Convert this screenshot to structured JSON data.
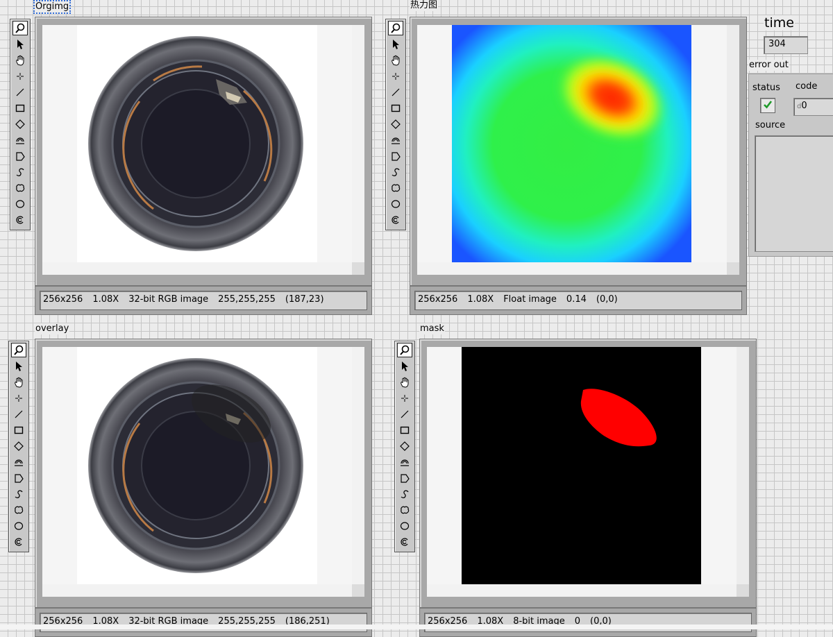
{
  "panels": {
    "orgimg": {
      "label": "Orgimg",
      "status": {
        "size": "256x256",
        "zoom": "1.08X",
        "type": "32-bit RGB image",
        "value": "255,255,255",
        "coords": "(187,23)"
      }
    },
    "heatmap": {
      "label": "热力图",
      "status": {
        "size": "256x256",
        "zoom": "1.08X",
        "type": "Float image",
        "value": "0.14",
        "coords": "(0,0)"
      }
    },
    "overlay": {
      "label": "overlay",
      "status": {
        "size": "256x256",
        "zoom": "1.08X",
        "type": "32-bit RGB image",
        "value": "255,255,255",
        "coords": "(186,251)"
      }
    },
    "mask": {
      "label": "mask",
      "status": {
        "size": "256x256",
        "zoom": "1.08X",
        "type": "8-bit image",
        "value": "0",
        "coords": "(0,0)"
      }
    }
  },
  "time": {
    "label": "time",
    "value": "304"
  },
  "error_out": {
    "label": "error out",
    "status_label": "status",
    "code_label": "code",
    "code_value": "0",
    "code_prefix": "d",
    "source_label": "source",
    "source_value": "",
    "status_ok": true
  },
  "tools": [
    "zoom-tool",
    "pointer-tool",
    "pan-tool",
    "point-tool",
    "line-tool",
    "rectangle-tool",
    "rotated-rectangle-tool",
    "annulus-tool",
    "polygon-tool",
    "freehand-line-tool",
    "freehand-region-tool",
    "oval-tool",
    "broken-annulus-tool"
  ],
  "colors": {
    "mask_fill": "#ff0000",
    "background": "#000000",
    "ok_check": "#22aa22"
  }
}
